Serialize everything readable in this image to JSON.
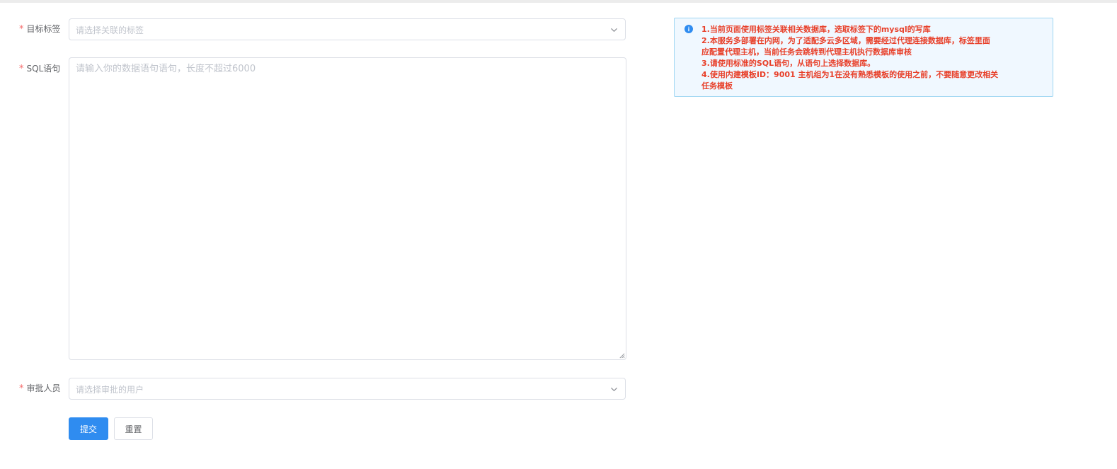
{
  "form": {
    "target_tag": {
      "required_mark": "*",
      "label": "目标标签",
      "placeholder": "请选择关联的标签"
    },
    "sql": {
      "required_mark": "*",
      "label": "SQL语句",
      "placeholder": "请输入你的数据语句语句，长度不超过6000"
    },
    "approver": {
      "required_mark": "*",
      "label": "审批人员",
      "placeholder": "请选择审批的用户"
    },
    "buttons": {
      "submit_label": "提交",
      "reset_label": "重置"
    }
  },
  "notice": {
    "icon": "info-icon",
    "lines": [
      "1.当前页面使用标签关联相关数据库，选取标签下的mysql的写库",
      "2.本服务多部署在内网，为了适配多云多区域，需要经过代理连接数据库，标签里面",
      "应配置代理主机，当前任务会跳转到代理主机执行数据库审核",
      "3.请使用标准的SQL语句，从语句上选择数据库。",
      "4.使用内建模板ID：9001 主机组为1在没有熟悉模板的使用之前，不要随意更改相关",
      "任务模板"
    ]
  },
  "colors": {
    "primary": "#2f8cf0",
    "required": "#f56c6c",
    "notice_text": "#e8402a",
    "notice_bg": "#f0f8ff",
    "notice_border": "#9fd6f2"
  }
}
